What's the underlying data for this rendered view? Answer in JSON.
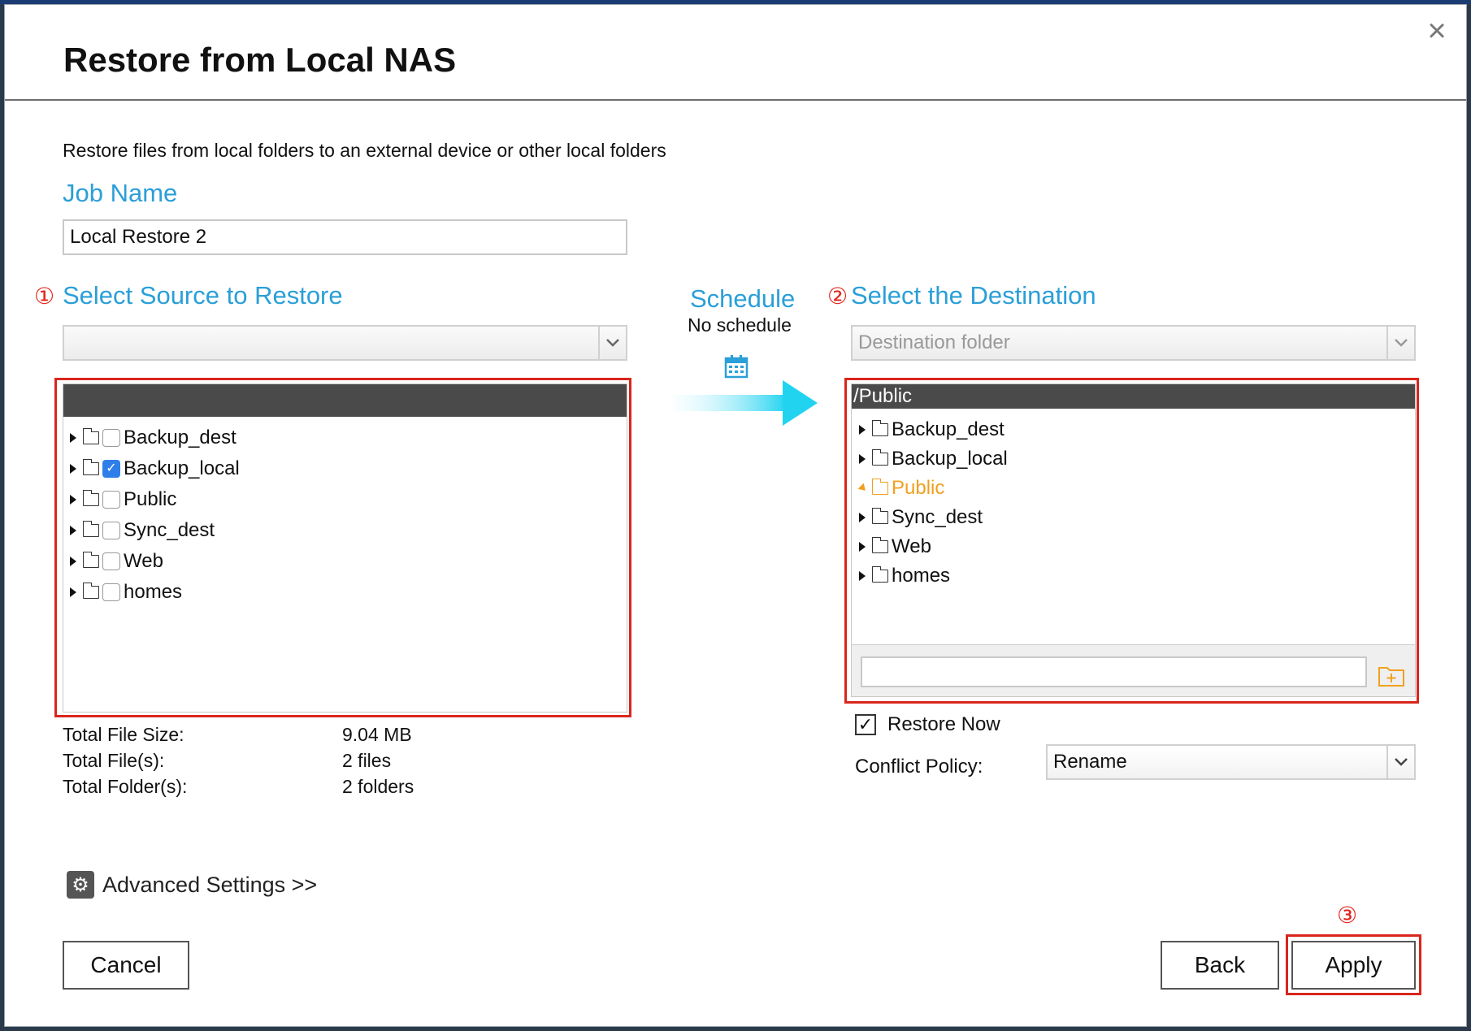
{
  "dialog": {
    "title": "Restore from Local NAS",
    "description": "Restore files from local folders to an external device or other local folders"
  },
  "job": {
    "heading": "Job Name",
    "value": "Local Restore 2"
  },
  "source": {
    "step": "①",
    "heading": "Select Source to Restore",
    "select_value": "",
    "tree": [
      {
        "label": "Backup_dest",
        "checked": false
      },
      {
        "label": "Backup_local",
        "checked": true
      },
      {
        "label": "Public",
        "checked": false
      },
      {
        "label": "Sync_dest",
        "checked": false
      },
      {
        "label": "Web",
        "checked": false
      },
      {
        "label": "homes",
        "checked": false
      }
    ],
    "stats": [
      {
        "label": "Total File Size:",
        "value": "9.04 MB"
      },
      {
        "label": "Total File(s):",
        "value": "2 files"
      },
      {
        "label": "Total Folder(s):",
        "value": "2 folders"
      }
    ]
  },
  "schedule": {
    "heading": "Schedule",
    "value": "No schedule",
    "icon": "calendar-icon"
  },
  "destination": {
    "step": "②",
    "heading": "Select the Destination",
    "select_placeholder": "Destination folder",
    "path": "/Public",
    "tree": [
      {
        "label": "Backup_dest",
        "selected": false
      },
      {
        "label": "Backup_local",
        "selected": false
      },
      {
        "label": "Public",
        "selected": true
      },
      {
        "label": "Sync_dest",
        "selected": false
      },
      {
        "label": "Web",
        "selected": false
      },
      {
        "label": "homes",
        "selected": false
      }
    ],
    "new_folder_value": "",
    "restore_now_label": "Restore Now",
    "restore_now_checked": true,
    "conflict_label": "Conflict Policy:",
    "conflict_value": "Rename"
  },
  "advanced": {
    "label": "Advanced Settings >>"
  },
  "footer": {
    "cancel": "Cancel",
    "back": "Back",
    "apply": "Apply",
    "apply_step": "③"
  },
  "colors": {
    "accent": "#2a9fd8",
    "highlight": "#d9261c",
    "selected_folder": "#f0a020",
    "checkbox_on": "#2f7fea",
    "tree_header": "#4a4a4a"
  }
}
